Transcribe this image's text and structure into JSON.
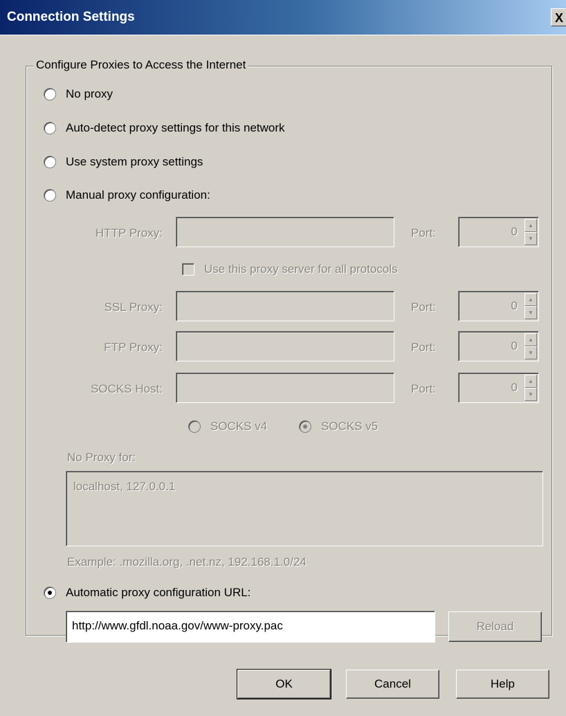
{
  "window": {
    "title": "Connection Settings",
    "close_label": "X"
  },
  "group": {
    "legend": "Configure Proxies to Access the Internet"
  },
  "radios": {
    "no_proxy": "No proxy",
    "auto_detect": "Auto-detect proxy settings for this network",
    "system": "Use system proxy settings",
    "manual": "Manual proxy configuration:",
    "auto_url": "Automatic proxy configuration URL:",
    "selected": "auto_url"
  },
  "manual": {
    "http_label": "HTTP Proxy:",
    "ssl_label": "SSL Proxy:",
    "ftp_label": "FTP Proxy:",
    "socks_label": "SOCKS Host:",
    "port_label": "Port:",
    "http_port": "0",
    "ssl_port": "0",
    "ftp_port": "0",
    "socks_port": "0",
    "same_proxy_label": "Use this proxy server for all protocols",
    "socks_v4": "SOCKS v4",
    "socks_v5": "SOCKS v5",
    "no_proxy_label": "No Proxy for:",
    "no_proxy_value": "localhost, 127.0.0.1",
    "example": "Example: .mozilla.org, .net.nz, 192.168.1.0/24"
  },
  "auto": {
    "url": "http://www.gfdl.noaa.gov/www-proxy.pac",
    "reload_label": "Reload"
  },
  "buttons": {
    "ok": "OK",
    "cancel": "Cancel",
    "help": "Help"
  }
}
